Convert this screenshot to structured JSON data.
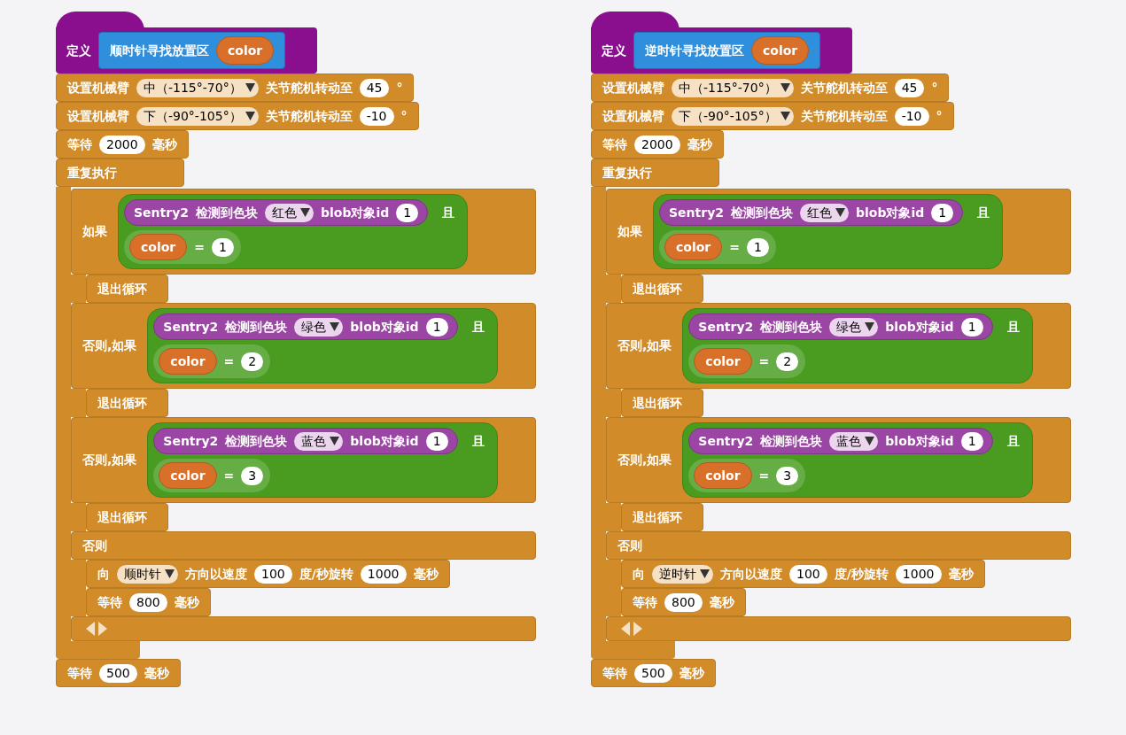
{
  "scripts": [
    {
      "define": {
        "label": "定义",
        "name": "顺时针寻找放置区",
        "param": "color"
      },
      "arm_blocks": [
        {
          "label": "设置机械臂",
          "joint": "中（-115°-70°）",
          "action": "关节舵机转动至",
          "value": "45",
          "unit": "°"
        },
        {
          "label": "设置机械臂",
          "joint": "下（-90°-105°）",
          "action": "关节舵机转动至",
          "value": "-10",
          "unit": "°"
        }
      ],
      "wait": {
        "label": "等待",
        "value": "2000",
        "unit": "毫秒"
      },
      "loop": {
        "label": "重复执行",
        "branches": [
          {
            "label": "如果",
            "sensor": "Sentry2",
            "detect": "检测到色块",
            "color_choice": "红色",
            "blob": "blob对象id",
            "blob_id": "1",
            "and": "且",
            "var": "color",
            "op": "=",
            "var_value": "1",
            "break": "退出循环"
          },
          {
            "label": "否则,如果",
            "sensor": "Sentry2",
            "detect": "检测到色块",
            "color_choice": "绿色",
            "blob": "blob对象id",
            "blob_id": "1",
            "and": "且",
            "var": "color",
            "op": "=",
            "var_value": "2",
            "break": "退出循环"
          },
          {
            "label": "否则,如果",
            "sensor": "Sentry2",
            "detect": "检测到色块",
            "color_choice": "蓝色",
            "blob": "blob对象id",
            "blob_id": "1",
            "and": "且",
            "var": "color",
            "op": "=",
            "var_value": "3",
            "break": "退出循环"
          }
        ],
        "else": {
          "label": "否则",
          "rotate": {
            "label": "向",
            "direction": "顺时针",
            "speed_label": "方向以速度",
            "speed": "100",
            "rate_label": "度/秒旋转",
            "duration": "1000",
            "unit": "毫秒"
          },
          "wait": {
            "label": "等待",
            "value": "800",
            "unit": "毫秒"
          }
        }
      },
      "final_wait": {
        "label": "等待",
        "value": "500",
        "unit": "毫秒"
      }
    },
    {
      "define": {
        "label": "定义",
        "name": "逆时针寻找放置区",
        "param": "color"
      },
      "arm_blocks": [
        {
          "label": "设置机械臂",
          "joint": "中（-115°-70°）",
          "action": "关节舵机转动至",
          "value": "45",
          "unit": "°"
        },
        {
          "label": "设置机械臂",
          "joint": "下（-90°-105°）",
          "action": "关节舵机转动至",
          "value": "-10",
          "unit": "°"
        }
      ],
      "wait": {
        "label": "等待",
        "value": "2000",
        "unit": "毫秒"
      },
      "loop": {
        "label": "重复执行",
        "branches": [
          {
            "label": "如果",
            "sensor": "Sentry2",
            "detect": "检测到色块",
            "color_choice": "红色",
            "blob": "blob对象id",
            "blob_id": "1",
            "and": "且",
            "var": "color",
            "op": "=",
            "var_value": "1",
            "break": "退出循环"
          },
          {
            "label": "否则,如果",
            "sensor": "Sentry2",
            "detect": "检测到色块",
            "color_choice": "绿色",
            "blob": "blob对象id",
            "blob_id": "1",
            "and": "且",
            "var": "color",
            "op": "=",
            "var_value": "2",
            "break": "退出循环"
          },
          {
            "label": "否则,如果",
            "sensor": "Sentry2",
            "detect": "检测到色块",
            "color_choice": "蓝色",
            "blob": "blob对象id",
            "blob_id": "1",
            "and": "且",
            "var": "color",
            "op": "=",
            "var_value": "3",
            "break": "退出循环"
          }
        ],
        "else": {
          "label": "否则",
          "rotate": {
            "label": "向",
            "direction": "逆时针",
            "speed_label": "方向以速度",
            "speed": "100",
            "rate_label": "度/秒旋转",
            "duration": "1000",
            "unit": "毫秒"
          },
          "wait": {
            "label": "等待",
            "value": "800",
            "unit": "毫秒"
          }
        }
      },
      "final_wait": {
        "label": "等待",
        "value": "500",
        "unit": "毫秒"
      }
    }
  ]
}
